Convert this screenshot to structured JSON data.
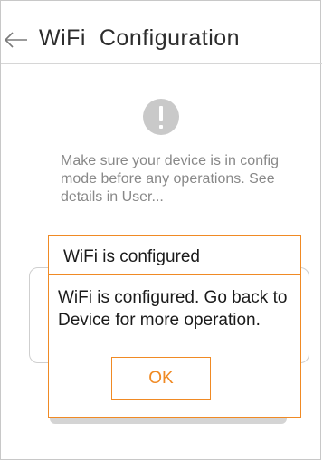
{
  "header": {
    "title": "WiFi  Configuration",
    "back_icon": "back-arrow-icon"
  },
  "info": {
    "icon": "exclamation-icon",
    "message": "Make sure your device is in config mode before any operations. See details in User..."
  },
  "dialog": {
    "title": "WiFi is configured",
    "message": "WiFi is configured. Go back to Device for more operation.",
    "ok_label": "OK"
  },
  "colors": {
    "accent": "#f08a24",
    "icon_gray": "#c9c9c9",
    "text_muted": "#888888"
  }
}
